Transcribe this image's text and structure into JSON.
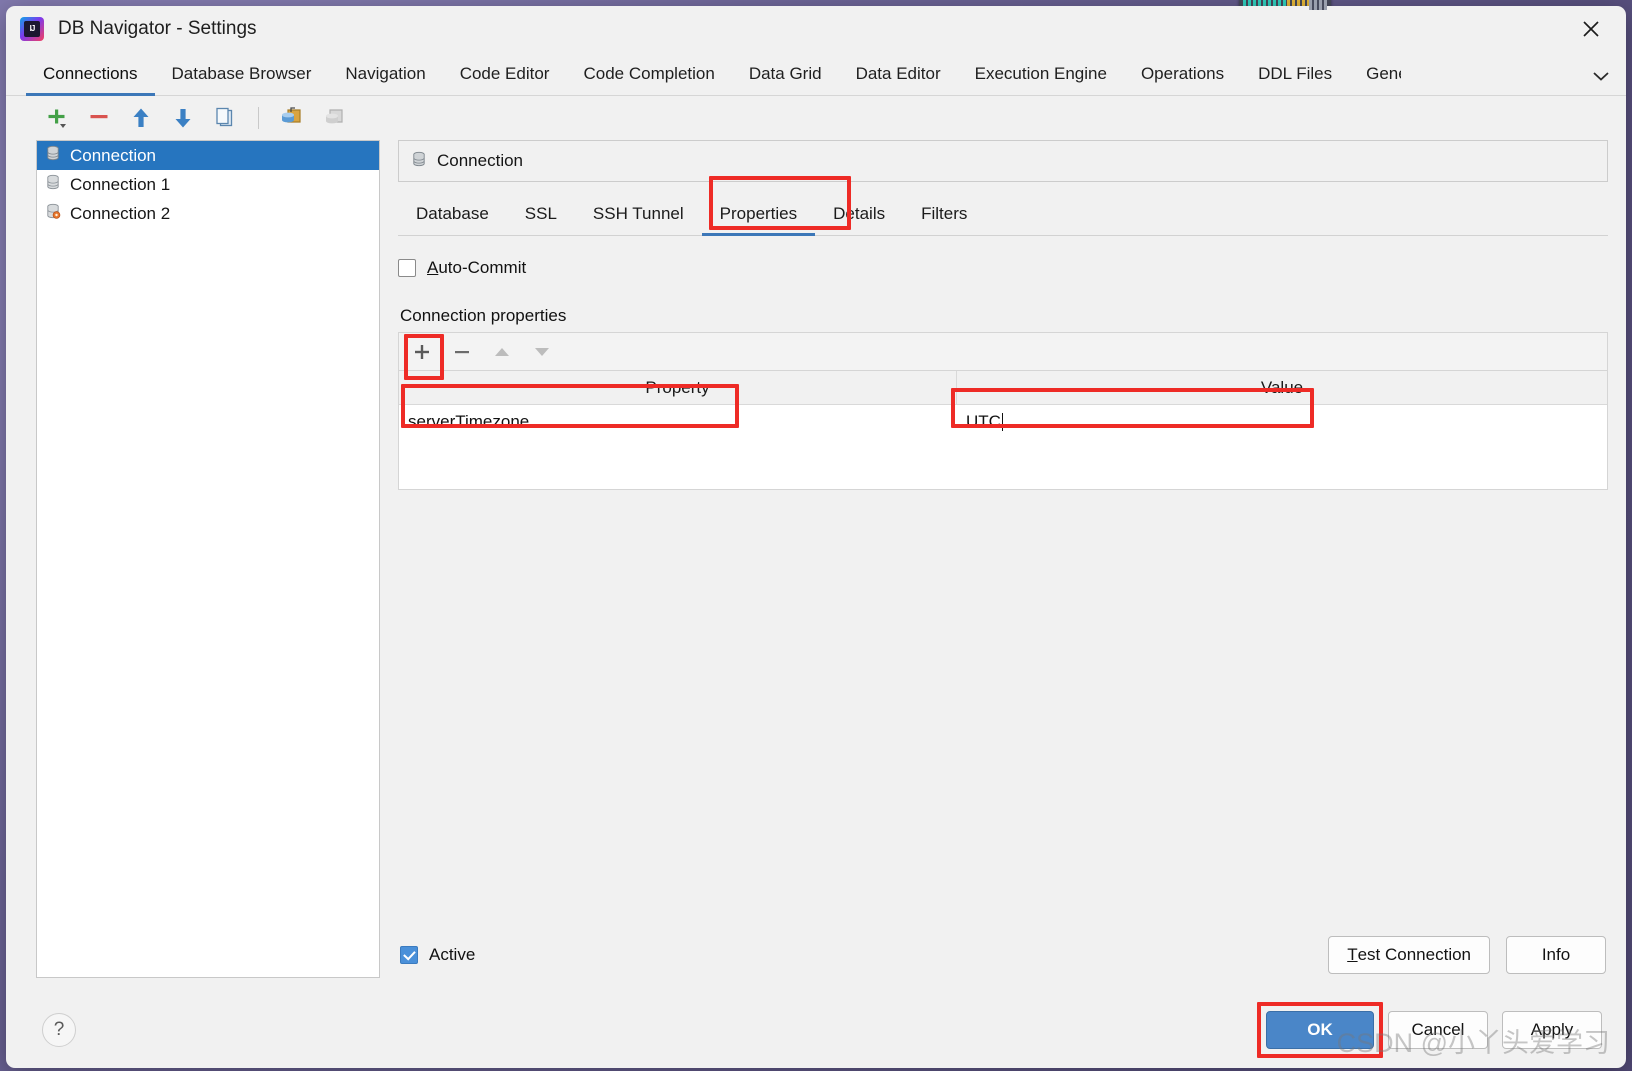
{
  "window": {
    "title": "DB Navigator - Settings",
    "app_icon": "intellij-idea-icon",
    "close_label": "✕"
  },
  "top_tabs": {
    "active": "Connections",
    "items": [
      {
        "label": "Connections"
      },
      {
        "label": "Database Browser"
      },
      {
        "label": "Navigation"
      },
      {
        "label": "Code Editor"
      },
      {
        "label": "Code Completion"
      },
      {
        "label": "Data Grid"
      },
      {
        "label": "Data Editor"
      },
      {
        "label": "Execution Engine"
      },
      {
        "label": "Operations"
      },
      {
        "label": "DDL Files"
      },
      {
        "label": "Gene"
      }
    ],
    "overflow_icon": "chevron-down-icon"
  },
  "list_toolbar": {
    "items": [
      {
        "name": "add-connection-button",
        "icon": "plus-green-icon"
      },
      {
        "name": "remove-connection-button",
        "icon": "minus-red-icon"
      },
      {
        "name": "move-up-button",
        "icon": "arrow-up-blue-icon"
      },
      {
        "name": "move-down-button",
        "icon": "arrow-down-blue-icon"
      },
      {
        "name": "duplicate-connection-button",
        "icon": "copy-icon"
      },
      {
        "name": "import-connection-button",
        "icon": "database-import-icon"
      },
      {
        "name": "export-connection-button",
        "icon": "database-export-icon"
      }
    ]
  },
  "connections": {
    "selected_index": 0,
    "items": [
      {
        "label": "Connection",
        "icon": "database-icon"
      },
      {
        "label": "Connection 1",
        "icon": "database-icon"
      },
      {
        "label": "Connection 2",
        "icon": "database-error-icon"
      }
    ]
  },
  "detail": {
    "header": {
      "title": "Connection",
      "icon": "database-icon"
    },
    "tabs": {
      "active": "Properties",
      "items": [
        {
          "label": "Database"
        },
        {
          "label": "SSL"
        },
        {
          "label": "SSH Tunnel"
        },
        {
          "label": "Properties"
        },
        {
          "label": "Details"
        },
        {
          "label": "Filters"
        }
      ]
    },
    "auto_commit": {
      "label": "Auto-Commit",
      "mnemonic": "A",
      "rest": "uto-Commit",
      "checked": false
    },
    "properties_section": {
      "label": "Connection properties",
      "toolbar": [
        {
          "name": "add-property-button",
          "icon": "plus-icon"
        },
        {
          "name": "remove-property-button",
          "icon": "minus-icon"
        },
        {
          "name": "move-property-up-button",
          "icon": "triangle-up-icon"
        },
        {
          "name": "move-property-down-button",
          "icon": "triangle-down-icon"
        }
      ],
      "columns": [
        "Property",
        "Value"
      ],
      "rows": [
        {
          "property": "serverTimezone",
          "value": "UTC"
        }
      ]
    },
    "active_checkbox": {
      "label": "Active",
      "checked": true
    },
    "test_connection_button": {
      "mnemonic": "T",
      "rest": "est Connection"
    },
    "info_button": {
      "label": "Info"
    }
  },
  "bottom": {
    "help_label": "?",
    "ok_label": "OK",
    "cancel_label": "Cancel",
    "apply_label": "Apply"
  },
  "watermark": {
    "text": "CSDN @小丫头爱学习"
  },
  "colors": {
    "accent_blue": "#3c77b8",
    "selection_blue": "#2675bf",
    "primary_button": "#4a86c8",
    "annotation_red": "#ee2b26"
  }
}
